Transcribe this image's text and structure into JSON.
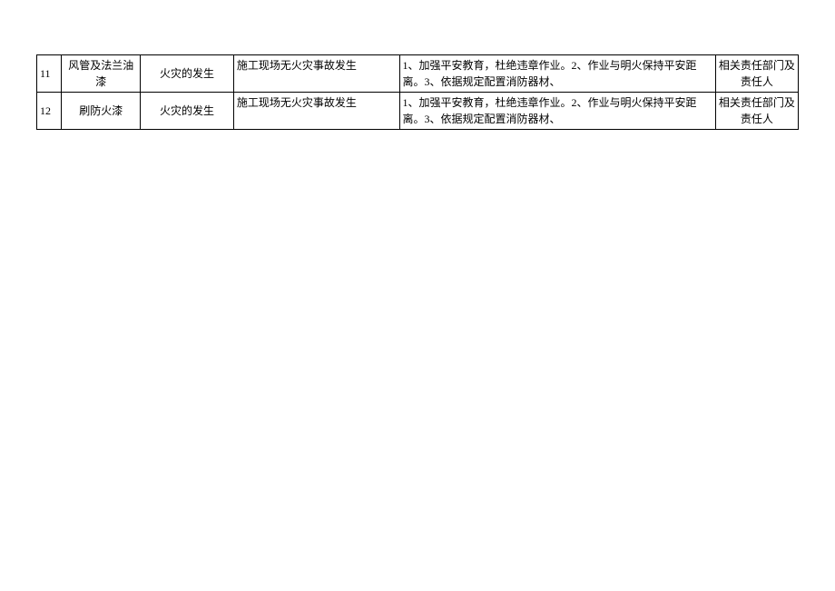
{
  "table": {
    "rows": [
      {
        "num": "11",
        "item": "风管及法兰油漆",
        "hazard": "火灾的发生",
        "goal": "施工现场无火灾事故发生",
        "measure": "1、加强平安教育，杜绝违章作业。2、作业与明火保持平安距离。3、依据规定配置消防器材、",
        "resp": "相关责任部门及责任人"
      },
      {
        "num": "12",
        "item": "刷防火漆",
        "hazard": "火灾的发生",
        "goal": "施工现场无火灾事故发生",
        "measure": "1、加强平安教育，杜绝违章作业。2、作业与明火保持平安距离。3、依据规定配置消防器材、",
        "resp": "相关责任部门及责任人"
      }
    ]
  }
}
